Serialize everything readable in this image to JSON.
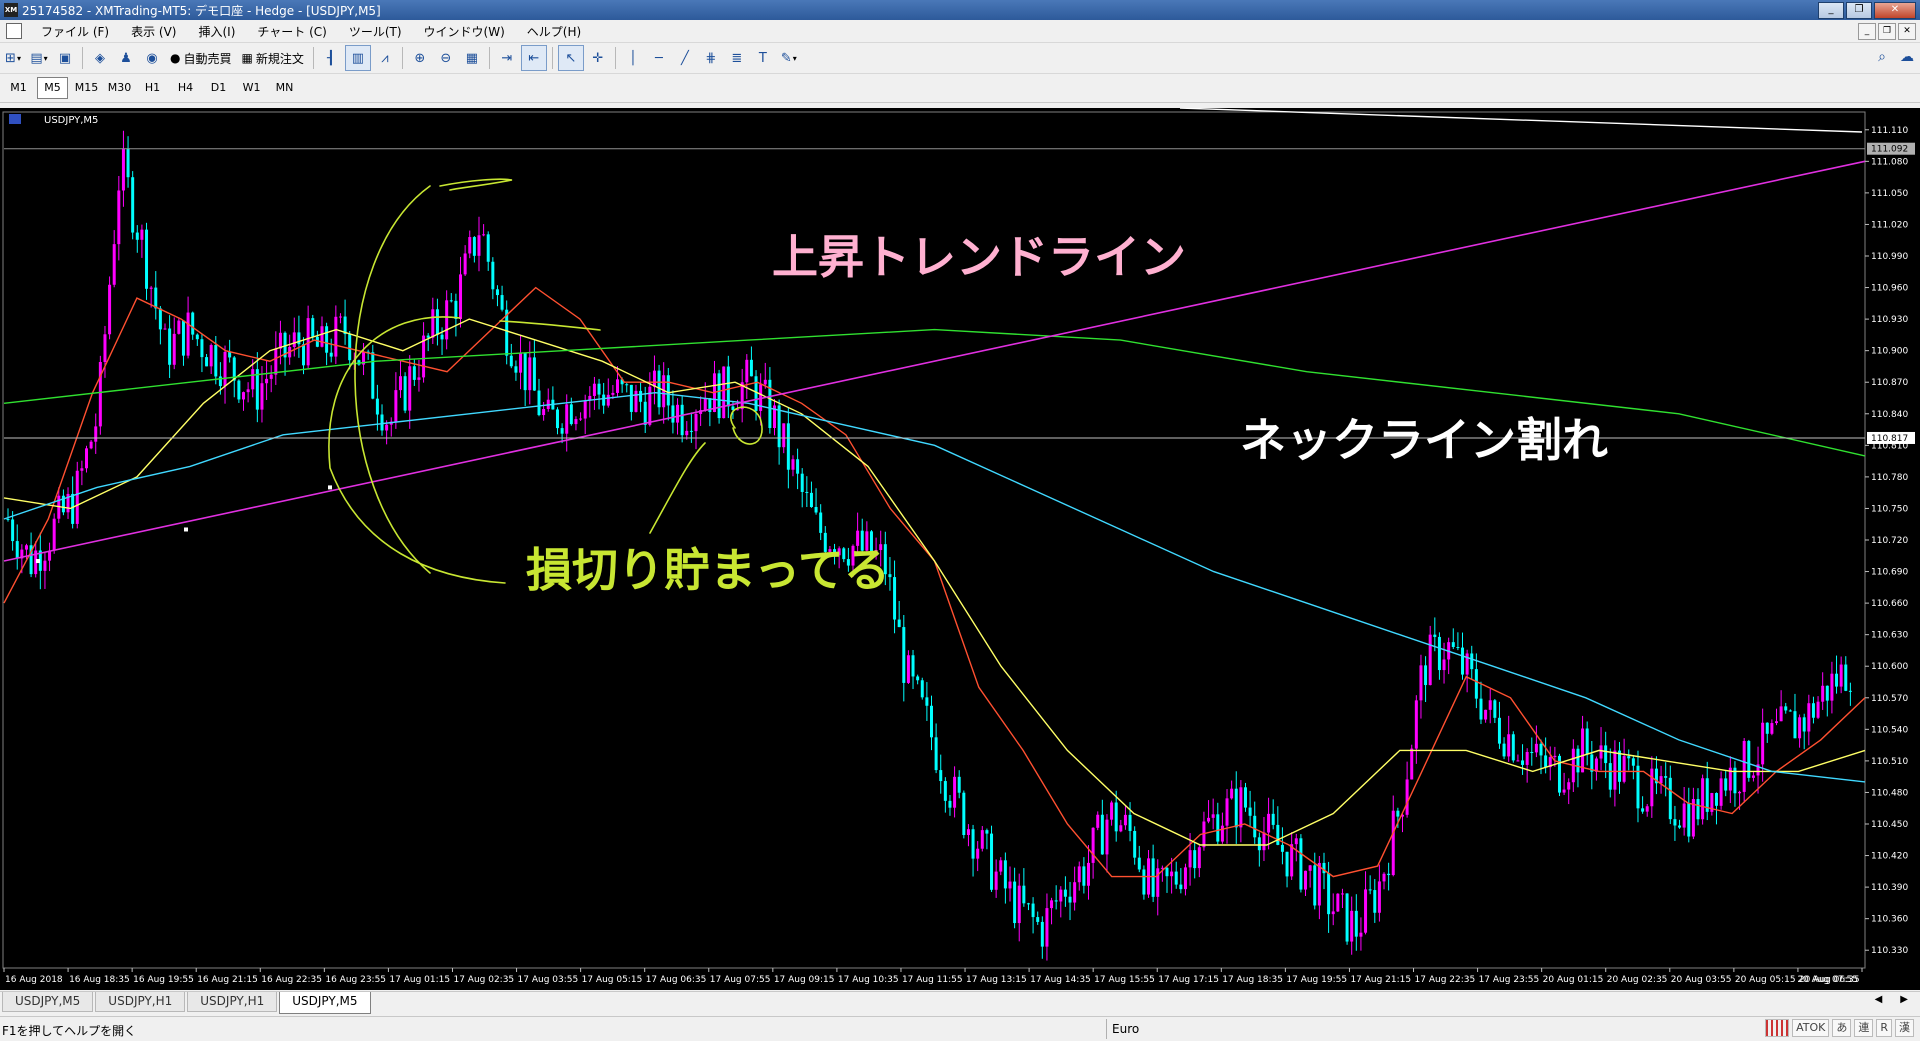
{
  "window": {
    "title": "25174582 - XMTrading-MT5: デモ口座 - Hedge - [USDJPY,M5]",
    "app_icon": "XM",
    "minimize_icon": "_",
    "restore_icon": "❐",
    "close_icon": "✕",
    "mdi_minimize_icon": "_",
    "mdi_restore_icon": "❐",
    "mdi_close_icon": "✕"
  },
  "menu": [
    "ファイル (F)",
    "表示 (V)",
    "挿入(I)",
    "チャート (C)",
    "ツール(T)",
    "ウインドウ(W)",
    "ヘルプ(H)"
  ],
  "toolbar": {
    "auto_trade_label": "自動売買",
    "new_order_label": "新規注文",
    "search_icon": "search-icon",
    "chat_icon": "chat-icon"
  },
  "timeframes": [
    "M1",
    "M5",
    "M15",
    "M30",
    "H1",
    "H4",
    "D1",
    "W1",
    "MN"
  ],
  "active_timeframe": "M5",
  "chart": {
    "symbol_label": "USDJPY,M5",
    "annotations": {
      "uptrend": "上昇トレンドライン",
      "neckline": "ネックライン割れ",
      "stoploss": "損切り貯まってる"
    },
    "colors": {
      "background": "#000000",
      "bull_candle": "#ff00ff",
      "bear_candle": "#00ffff",
      "ma_fast": "#ff5030",
      "ma_mid": "#ffff66",
      "ma_slow": "#40d8ff",
      "ma_long": "#30e030",
      "trendline": "#e030e0",
      "handwriting": "#c8e632",
      "uptrend_text": "#ffb0d0",
      "neckline_text": "#ffffff",
      "stoploss_text": "#c8e632"
    }
  },
  "chart_data": {
    "type": "candlestick",
    "symbol": "USDJPY",
    "timeframe": "M5",
    "y_axis_ticks": [
      "111.110",
      "111.080",
      "111.050",
      "111.020",
      "110.990",
      "110.960",
      "110.930",
      "110.900",
      "110.870",
      "110.840",
      "110.810",
      "110.780",
      "110.750",
      "110.720",
      "110.690",
      "110.660",
      "110.630",
      "110.600",
      "110.570",
      "110.540",
      "110.510",
      "110.480",
      "110.450",
      "110.420",
      "110.390",
      "110.360",
      "110.330"
    ],
    "ylim": [
      110.315,
      111.125
    ],
    "current_price": "111.092",
    "hline_price": "110.817",
    "x_axis_ticks": [
      "16 Aug 2018",
      "16 Aug 18:35",
      "16 Aug 19:55",
      "16 Aug 21:15",
      "16 Aug 22:35",
      "16 Aug 23:55",
      "17 Aug 01:15",
      "17 Aug 02:35",
      "17 Aug 03:55",
      "17 Aug 05:15",
      "17 Aug 06:35",
      "17 Aug 07:55",
      "17 Aug 09:15",
      "17 Aug 10:35",
      "17 Aug 11:55",
      "17 Aug 13:15",
      "17 Aug 14:35",
      "17 Aug 15:55",
      "17 Aug 17:15",
      "17 Aug 18:35",
      "17 Aug 19:55",
      "17 Aug 21:15",
      "17 Aug 22:35",
      "17 Aug 23:55",
      "20 Aug 01:15",
      "20 Aug 02:35",
      "20 Aug 03:55",
      "20 Aug 05:15",
      "20 Aug 06:35",
      "20 Aug 07:55"
    ],
    "close_path": [
      110.74,
      110.7,
      110.73,
      110.76,
      110.84,
      111.08,
      111.0,
      110.9,
      110.92,
      110.9,
      110.88,
      110.86,
      110.89,
      110.91,
      110.9,
      110.92,
      110.88,
      110.83,
      110.88,
      110.92,
      110.95,
      111.02,
      110.93,
      110.88,
      110.83,
      110.85,
      110.86,
      110.86,
      110.85,
      110.86,
      110.84,
      110.86,
      110.86,
      110.87,
      110.84,
      110.78,
      110.73,
      110.72,
      110.71,
      110.7,
      110.59,
      110.54,
      110.48,
      110.44,
      110.4,
      110.37,
      110.35,
      110.39,
      110.41,
      110.46,
      110.44,
      110.38,
      110.4,
      110.44,
      110.46,
      110.47,
      110.44,
      110.42,
      110.4,
      110.37,
      110.35,
      110.39,
      110.47,
      110.6,
      110.62,
      110.59,
      110.55,
      110.53,
      110.51,
      110.5,
      110.52,
      110.51,
      110.5,
      110.48,
      110.47,
      110.46,
      110.49,
      110.5,
      110.52,
      110.54,
      110.55,
      110.58,
      110.6
    ],
    "series": [
      {
        "name": "MA fast",
        "values": [
          110.66,
          110.74,
          110.86,
          110.95,
          110.93,
          110.9,
          110.89,
          110.91,
          110.9,
          110.89,
          110.88,
          110.92,
          110.96,
          110.93,
          110.87,
          110.87,
          110.86,
          110.87,
          110.85,
          110.82,
          110.75,
          110.7,
          110.58,
          110.52,
          110.45,
          110.4,
          110.4,
          110.44,
          110.45,
          110.43,
          110.4,
          110.41,
          110.5,
          110.59,
          110.57,
          110.51,
          110.5,
          110.5,
          110.47,
          110.46,
          110.5,
          110.53,
          110.57
        ]
      },
      {
        "name": "MA mid",
        "values": [
          110.76,
          110.75,
          110.78,
          110.85,
          110.9,
          110.92,
          110.9,
          110.93,
          110.91,
          110.89,
          110.86,
          110.87,
          110.84,
          110.79,
          110.7,
          110.6,
          110.52,
          110.46,
          110.43,
          110.43,
          110.46,
          110.52,
          110.52,
          110.5,
          110.52,
          110.51,
          110.5,
          110.5,
          110.52
        ]
      },
      {
        "name": "MA slow",
        "values": [
          110.74,
          110.77,
          110.79,
          110.82,
          110.83,
          110.84,
          110.85,
          110.86,
          110.85,
          110.83,
          110.81,
          110.77,
          110.73,
          110.69,
          110.66,
          110.63,
          110.6,
          110.57,
          110.53,
          110.5,
          110.49
        ]
      },
      {
        "name": "MA long",
        "values": [
          110.85,
          110.87,
          110.89,
          110.9,
          110.91,
          110.92,
          110.91,
          110.88,
          110.86,
          110.84,
          110.8
        ]
      },
      {
        "name": "Trendline",
        "values": [
          110.7,
          111.08
        ]
      }
    ]
  },
  "chart_tabs": [
    "USDJPY,M5",
    "USDJPY,H1",
    "USDJPY,H1",
    "USDJPY,M5"
  ],
  "active_chart_tab": 3,
  "status": {
    "help": "F1を押してヘルプを開く",
    "profile": "Euro",
    "ime": [
      "ATOK",
      "あ",
      "連",
      "R",
      "漢"
    ]
  }
}
